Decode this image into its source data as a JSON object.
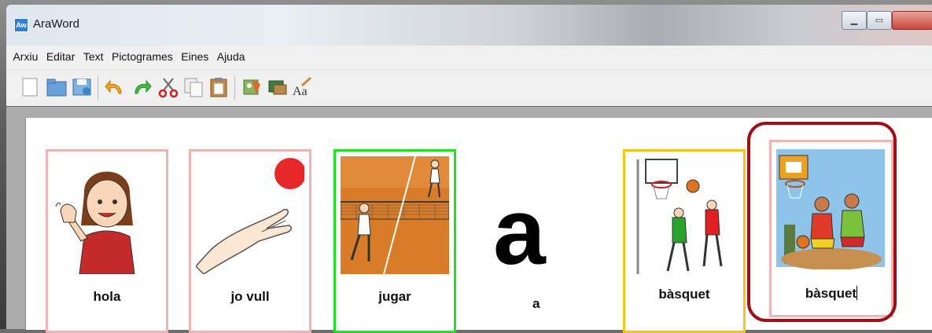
{
  "window": {
    "title": "AraWord",
    "icon": "app-icon"
  },
  "menu": [
    "Arxiu",
    "Editar",
    "Text",
    "Pictogrames",
    "Eines",
    "Ajuda"
  ],
  "toolbar": [
    "new-document-icon",
    "open-folder-icon",
    "save-icon",
    "undo-icon",
    "redo-icon",
    "cut-icon",
    "copy-icon",
    "paste-icon",
    "insert-pictogram-icon",
    "change-image-icon",
    "font-style-icon"
  ],
  "cards": [
    {
      "word": "hola",
      "border": "#f0b4b4",
      "picture": "girl-waving"
    },
    {
      "word": "jo vull",
      "border": "#f0b4b4",
      "picture": "hand-reaching-ball"
    },
    {
      "word": "jugar",
      "border": "#22e022",
      "picture": "tennis-court"
    },
    {
      "word": "a",
      "border": "none",
      "picture": "letter-a"
    },
    {
      "word": "bàsquet",
      "border": "#f5c518",
      "picture": "basketball-players"
    },
    {
      "word": "bàsquet",
      "border": "#f0b4b4",
      "picture": "basketball-colour"
    }
  ],
  "colors": {
    "highlight": "#a30e14"
  }
}
